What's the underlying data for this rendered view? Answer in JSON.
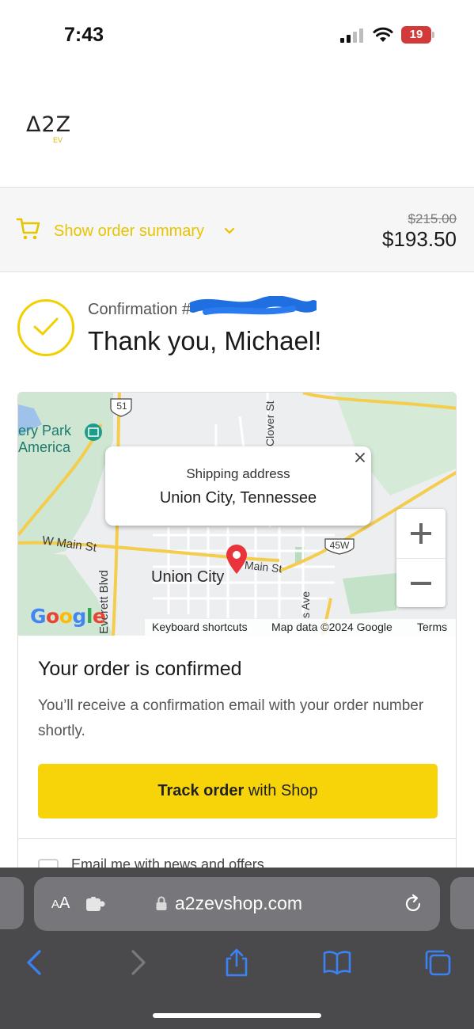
{
  "status_bar": {
    "time": "7:43",
    "battery": "19"
  },
  "brand": {
    "logo": "Δ2Z",
    "logo_sub": "EV"
  },
  "summary": {
    "label": "Show order summary",
    "original_price": "$215.00",
    "price": "$193.50"
  },
  "confirmation": {
    "label": "Confirmation #",
    "thanks": "Thank you, Michael!"
  },
  "map": {
    "popup_title": "Shipping address",
    "popup_address": "Union City, Tennessee",
    "labels": {
      "park1": "ery Park",
      "park2": "America",
      "main_st_w": "W Main St",
      "main_st": "Main St",
      "union_city": "Union City",
      "everett": "Everett Blvd",
      "clover": "Clover St",
      "route51": "51",
      "route45w": "45W",
      "s_ave": "s Ave"
    },
    "google": "Google",
    "attribution": {
      "shortcuts": "Keyboard shortcuts",
      "data": "Map data ©2024 Google",
      "terms": "Terms"
    }
  },
  "order": {
    "heading": "Your order is confirmed",
    "description": "You’ll receive a confirmation email with your order number shortly.",
    "track_bold": "Track order",
    "track_rest": " with Shop",
    "email_option": "Email me with news and offers"
  },
  "browser": {
    "aa_small": "A",
    "aa_large": "A",
    "url": "a2zevshop.com"
  },
  "colors": {
    "accent": "#F7D40A",
    "accent_text": "#E7C400",
    "pin": "#E8343A",
    "safari_bg": "#4A4A4C",
    "safari_blue": "#3B82F6"
  }
}
